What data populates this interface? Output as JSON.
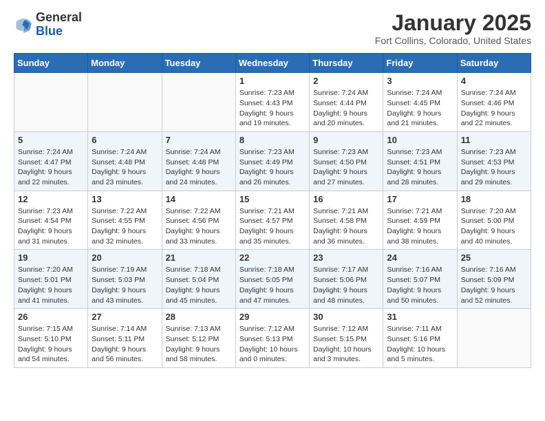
{
  "header": {
    "logo_general": "General",
    "logo_blue": "Blue",
    "month_title": "January 2025",
    "location": "Fort Collins, Colorado, United States"
  },
  "weekdays": [
    "Sunday",
    "Monday",
    "Tuesday",
    "Wednesday",
    "Thursday",
    "Friday",
    "Saturday"
  ],
  "weeks": [
    [
      {
        "day": "",
        "sunrise": "",
        "sunset": "",
        "daylight": ""
      },
      {
        "day": "",
        "sunrise": "",
        "sunset": "",
        "daylight": ""
      },
      {
        "day": "",
        "sunrise": "",
        "sunset": "",
        "daylight": ""
      },
      {
        "day": "1",
        "sunrise": "Sunrise: 7:23 AM",
        "sunset": "Sunset: 4:43 PM",
        "daylight": "Daylight: 9 hours and 19 minutes."
      },
      {
        "day": "2",
        "sunrise": "Sunrise: 7:24 AM",
        "sunset": "Sunset: 4:44 PM",
        "daylight": "Daylight: 9 hours and 20 minutes."
      },
      {
        "day": "3",
        "sunrise": "Sunrise: 7:24 AM",
        "sunset": "Sunset: 4:45 PM",
        "daylight": "Daylight: 9 hours and 21 minutes."
      },
      {
        "day": "4",
        "sunrise": "Sunrise: 7:24 AM",
        "sunset": "Sunset: 4:46 PM",
        "daylight": "Daylight: 9 hours and 22 minutes."
      }
    ],
    [
      {
        "day": "5",
        "sunrise": "Sunrise: 7:24 AM",
        "sunset": "Sunset: 4:47 PM",
        "daylight": "Daylight: 9 hours and 22 minutes."
      },
      {
        "day": "6",
        "sunrise": "Sunrise: 7:24 AM",
        "sunset": "Sunset: 4:48 PM",
        "daylight": "Daylight: 9 hours and 23 minutes."
      },
      {
        "day": "7",
        "sunrise": "Sunrise: 7:24 AM",
        "sunset": "Sunset: 4:48 PM",
        "daylight": "Daylight: 9 hours and 24 minutes."
      },
      {
        "day": "8",
        "sunrise": "Sunrise: 7:23 AM",
        "sunset": "Sunset: 4:49 PM",
        "daylight": "Daylight: 9 hours and 26 minutes."
      },
      {
        "day": "9",
        "sunrise": "Sunrise: 7:23 AM",
        "sunset": "Sunset: 4:50 PM",
        "daylight": "Daylight: 9 hours and 27 minutes."
      },
      {
        "day": "10",
        "sunrise": "Sunrise: 7:23 AM",
        "sunset": "Sunset: 4:51 PM",
        "daylight": "Daylight: 9 hours and 28 minutes."
      },
      {
        "day": "11",
        "sunrise": "Sunrise: 7:23 AM",
        "sunset": "Sunset: 4:53 PM",
        "daylight": "Daylight: 9 hours and 29 minutes."
      }
    ],
    [
      {
        "day": "12",
        "sunrise": "Sunrise: 7:23 AM",
        "sunset": "Sunset: 4:54 PM",
        "daylight": "Daylight: 9 hours and 31 minutes."
      },
      {
        "day": "13",
        "sunrise": "Sunrise: 7:22 AM",
        "sunset": "Sunset: 4:55 PM",
        "daylight": "Daylight: 9 hours and 32 minutes."
      },
      {
        "day": "14",
        "sunrise": "Sunrise: 7:22 AM",
        "sunset": "Sunset: 4:56 PM",
        "daylight": "Daylight: 9 hours and 33 minutes."
      },
      {
        "day": "15",
        "sunrise": "Sunrise: 7:21 AM",
        "sunset": "Sunset: 4:57 PM",
        "daylight": "Daylight: 9 hours and 35 minutes."
      },
      {
        "day": "16",
        "sunrise": "Sunrise: 7:21 AM",
        "sunset": "Sunset: 4:58 PM",
        "daylight": "Daylight: 9 hours and 36 minutes."
      },
      {
        "day": "17",
        "sunrise": "Sunrise: 7:21 AM",
        "sunset": "Sunset: 4:59 PM",
        "daylight": "Daylight: 9 hours and 38 minutes."
      },
      {
        "day": "18",
        "sunrise": "Sunrise: 7:20 AM",
        "sunset": "Sunset: 5:00 PM",
        "daylight": "Daylight: 9 hours and 40 minutes."
      }
    ],
    [
      {
        "day": "19",
        "sunrise": "Sunrise: 7:20 AM",
        "sunset": "Sunset: 5:01 PM",
        "daylight": "Daylight: 9 hours and 41 minutes."
      },
      {
        "day": "20",
        "sunrise": "Sunrise: 7:19 AM",
        "sunset": "Sunset: 5:03 PM",
        "daylight": "Daylight: 9 hours and 43 minutes."
      },
      {
        "day": "21",
        "sunrise": "Sunrise: 7:18 AM",
        "sunset": "Sunset: 5:04 PM",
        "daylight": "Daylight: 9 hours and 45 minutes."
      },
      {
        "day": "22",
        "sunrise": "Sunrise: 7:18 AM",
        "sunset": "Sunset: 5:05 PM",
        "daylight": "Daylight: 9 hours and 47 minutes."
      },
      {
        "day": "23",
        "sunrise": "Sunrise: 7:17 AM",
        "sunset": "Sunset: 5:06 PM",
        "daylight": "Daylight: 9 hours and 48 minutes."
      },
      {
        "day": "24",
        "sunrise": "Sunrise: 7:16 AM",
        "sunset": "Sunset: 5:07 PM",
        "daylight": "Daylight: 9 hours and 50 minutes."
      },
      {
        "day": "25",
        "sunrise": "Sunrise: 7:16 AM",
        "sunset": "Sunset: 5:09 PM",
        "daylight": "Daylight: 9 hours and 52 minutes."
      }
    ],
    [
      {
        "day": "26",
        "sunrise": "Sunrise: 7:15 AM",
        "sunset": "Sunset: 5:10 PM",
        "daylight": "Daylight: 9 hours and 54 minutes."
      },
      {
        "day": "27",
        "sunrise": "Sunrise: 7:14 AM",
        "sunset": "Sunset: 5:11 PM",
        "daylight": "Daylight: 9 hours and 56 minutes."
      },
      {
        "day": "28",
        "sunrise": "Sunrise: 7:13 AM",
        "sunset": "Sunset: 5:12 PM",
        "daylight": "Daylight: 9 hours and 58 minutes."
      },
      {
        "day": "29",
        "sunrise": "Sunrise: 7:12 AM",
        "sunset": "Sunset: 5:13 PM",
        "daylight": "Daylight: 10 hours and 0 minutes."
      },
      {
        "day": "30",
        "sunrise": "Sunrise: 7:12 AM",
        "sunset": "Sunset: 5:15 PM",
        "daylight": "Daylight: 10 hours and 3 minutes."
      },
      {
        "day": "31",
        "sunrise": "Sunrise: 7:11 AM",
        "sunset": "Sunset: 5:16 PM",
        "daylight": "Daylight: 10 hours and 5 minutes."
      },
      {
        "day": "",
        "sunrise": "",
        "sunset": "",
        "daylight": ""
      }
    ]
  ]
}
